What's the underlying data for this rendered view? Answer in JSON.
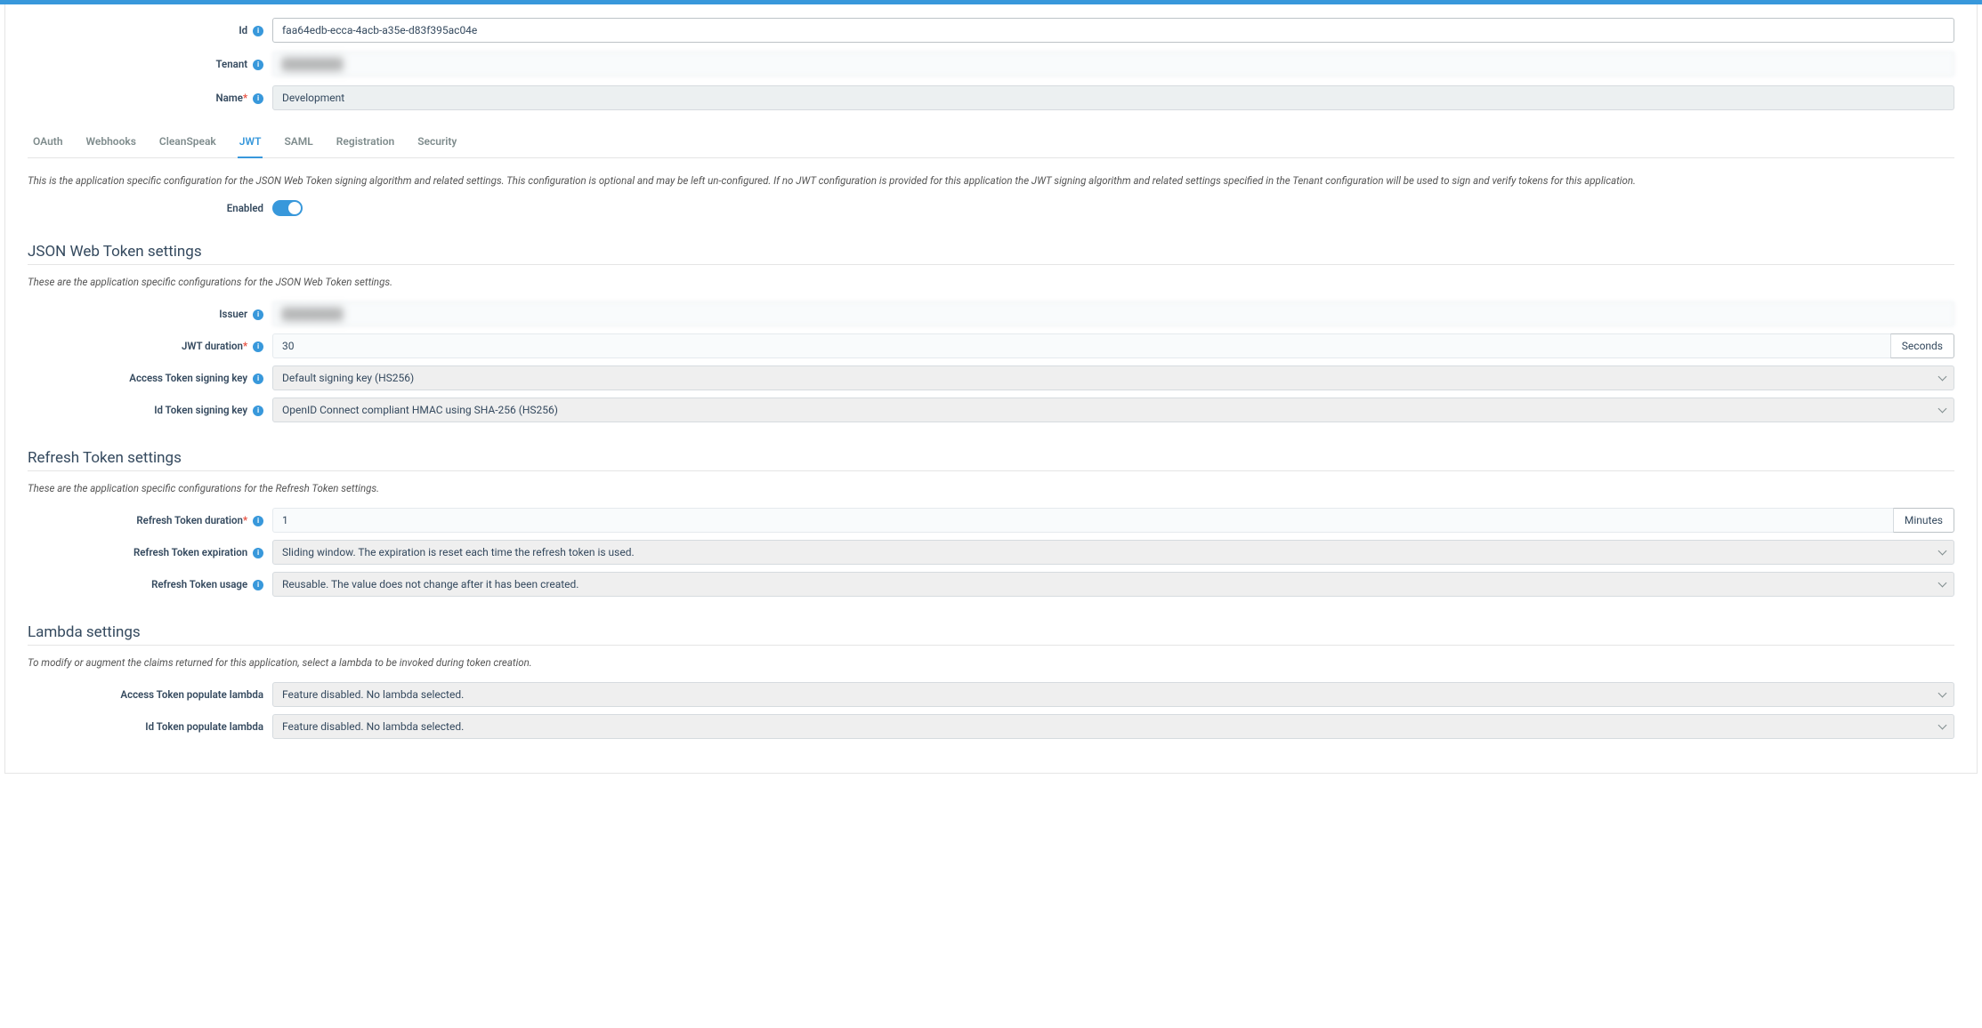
{
  "header": {
    "id_label": "Id",
    "id_value": "faa64edb-ecca-4acb-a35e-d83f395ac04e",
    "tenant_label": "Tenant",
    "tenant_value": "████████",
    "name_label": "Name",
    "name_value": "Development"
  },
  "tabs": [
    "OAuth",
    "Webhooks",
    "CleanSpeak",
    "JWT",
    "SAML",
    "Registration",
    "Security"
  ],
  "active_tab": "JWT",
  "jwt_tab": {
    "intro": "This is the application specific configuration for the JSON Web Token signing algorithm and related settings. This configuration is optional and may be left un-configured. If no JWT configuration is provided for this application the JWT signing algorithm and related settings specified in the Tenant configuration will be used to sign and verify tokens for this application.",
    "enabled_label": "Enabled",
    "enabled": true
  },
  "jwt_section": {
    "heading": "JSON Web Token settings",
    "desc": "These are the application specific configurations for the JSON Web Token settings.",
    "issuer_label": "Issuer",
    "issuer_value": "████████",
    "duration_label": "JWT duration",
    "duration_value": "30",
    "duration_unit": "Seconds",
    "access_key_label": "Access Token signing key",
    "access_key_value": "Default signing key (HS256)",
    "id_key_label": "Id Token signing key",
    "id_key_value": "OpenID Connect compliant HMAC using SHA-256 (HS256)"
  },
  "refresh_section": {
    "heading": "Refresh Token settings",
    "desc": "These are the application specific configurations for the Refresh Token settings.",
    "duration_label": "Refresh Token duration",
    "duration_value": "1",
    "duration_unit": "Minutes",
    "expiration_label": "Refresh Token expiration",
    "expiration_value": "Sliding window. The expiration is reset each time the refresh token is used.",
    "usage_label": "Refresh Token usage",
    "usage_value": "Reusable. The value does not change after it has been created."
  },
  "lambda_section": {
    "heading": "Lambda settings",
    "desc": "To modify or augment the claims returned for this application, select a lambda to be invoked during token creation.",
    "access_label": "Access Token populate lambda",
    "access_value": "Feature disabled. No lambda selected.",
    "id_label": "Id Token populate lambda",
    "id_value": "Feature disabled. No lambda selected."
  }
}
